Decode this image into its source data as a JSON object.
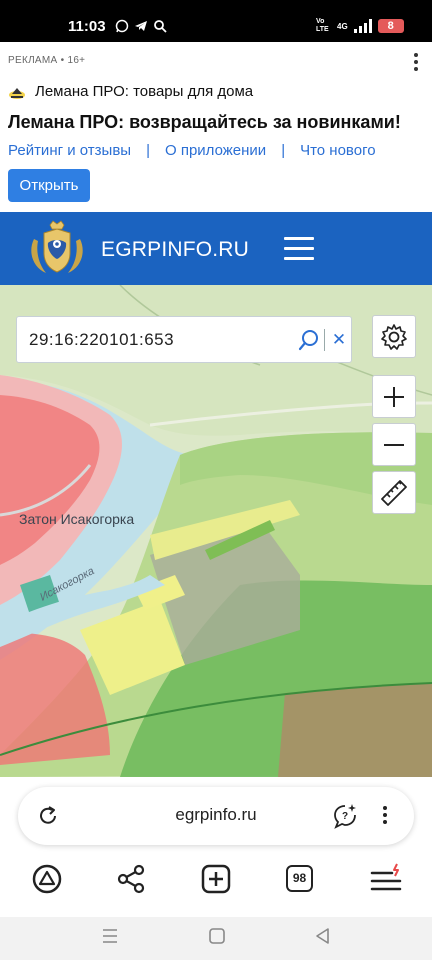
{
  "status_bar": {
    "time": "11:03",
    "network_label": "Vo LTE",
    "network_type": "4G",
    "battery": "8"
  },
  "ad": {
    "label": "РЕКЛАМА • 16+",
    "app_name": "Лемана ПРО: товары для дома",
    "title": "Лемана ПРО: возвращайтесь за новинками!",
    "links": [
      "Рейтинг и отзывы",
      "О приложении",
      "Что нового"
    ],
    "link_separator": "|",
    "open_button": "Открыть"
  },
  "site": {
    "name": "EGRPINFO.RU",
    "brand_color": "#1b63c0"
  },
  "map": {
    "search_value": "29:16:220101:653",
    "labels": {
      "settlement": "Затон Исакогорка",
      "river": "Исакогорка"
    }
  },
  "browser": {
    "url": "egrpinfo.ru",
    "tab_count": "98"
  }
}
